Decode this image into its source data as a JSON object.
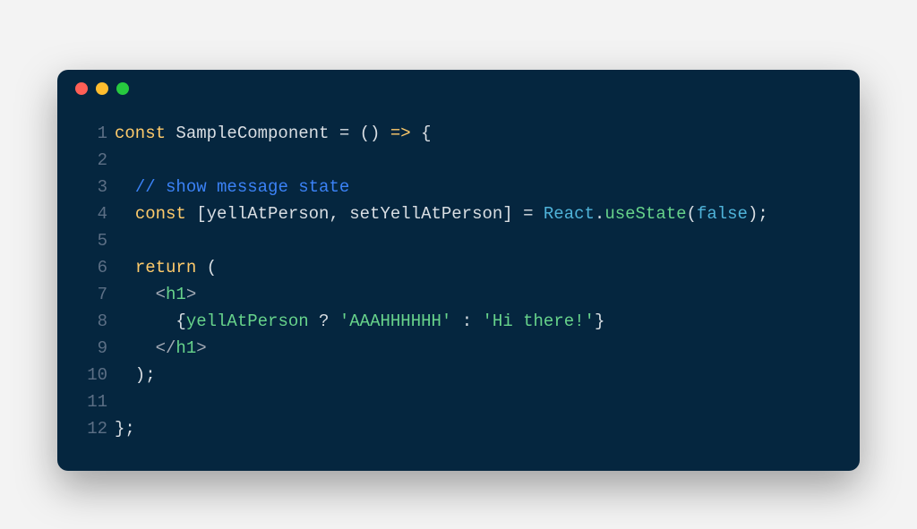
{
  "window": {
    "traffic_lights": [
      "red",
      "yellow",
      "green"
    ]
  },
  "code": {
    "lines": [
      {
        "n": "1",
        "tokens": [
          {
            "c": "tok-keyword",
            "t": "const"
          },
          {
            "c": "tok-default",
            "t": " SampleComponent = () "
          },
          {
            "c": "tok-keyword",
            "t": "=>"
          },
          {
            "c": "tok-default",
            "t": " {"
          }
        ]
      },
      {
        "n": "2",
        "tokens": [
          {
            "c": "tok-default",
            "t": ""
          }
        ]
      },
      {
        "n": "3",
        "tokens": [
          {
            "c": "tok-default",
            "t": "  "
          },
          {
            "c": "tok-comment",
            "t": "// show message state"
          }
        ]
      },
      {
        "n": "4",
        "tokens": [
          {
            "c": "tok-default",
            "t": "  "
          },
          {
            "c": "tok-keyword",
            "t": "const"
          },
          {
            "c": "tok-default",
            "t": " [yellAtPerson, setYellAtPerson] = "
          },
          {
            "c": "tok-class",
            "t": "React"
          },
          {
            "c": "tok-default",
            "t": "."
          },
          {
            "c": "tok-func",
            "t": "useState"
          },
          {
            "c": "tok-default",
            "t": "("
          },
          {
            "c": "tok-bool",
            "t": "false"
          },
          {
            "c": "tok-default",
            "t": ");"
          }
        ]
      },
      {
        "n": "5",
        "tokens": [
          {
            "c": "tok-default",
            "t": ""
          }
        ]
      },
      {
        "n": "6",
        "tokens": [
          {
            "c": "tok-default",
            "t": "  "
          },
          {
            "c": "tok-keyword",
            "t": "return"
          },
          {
            "c": "tok-default",
            "t": " ("
          }
        ]
      },
      {
        "n": "7",
        "tokens": [
          {
            "c": "tok-default",
            "t": "    "
          },
          {
            "c": "tok-tagpunc",
            "t": "<"
          },
          {
            "c": "tok-tag",
            "t": "h1"
          },
          {
            "c": "tok-tagpunc",
            "t": ">"
          }
        ]
      },
      {
        "n": "8",
        "tokens": [
          {
            "c": "tok-default",
            "t": "      {"
          },
          {
            "c": "tok-prop",
            "t": "yellAtPerson"
          },
          {
            "c": "tok-default",
            "t": " ? "
          },
          {
            "c": "tok-string",
            "t": "'AAAHHHHHH'"
          },
          {
            "c": "tok-default",
            "t": " : "
          },
          {
            "c": "tok-string",
            "t": "'Hi there!'"
          },
          {
            "c": "tok-default",
            "t": "}"
          }
        ]
      },
      {
        "n": "9",
        "tokens": [
          {
            "c": "tok-default",
            "t": "    "
          },
          {
            "c": "tok-tagpunc",
            "t": "</"
          },
          {
            "c": "tok-tag",
            "t": "h1"
          },
          {
            "c": "tok-tagpunc",
            "t": ">"
          }
        ]
      },
      {
        "n": "10",
        "tokens": [
          {
            "c": "tok-default",
            "t": "  );"
          }
        ]
      },
      {
        "n": "11",
        "tokens": [
          {
            "c": "tok-default",
            "t": ""
          }
        ]
      },
      {
        "n": "12",
        "tokens": [
          {
            "c": "tok-default",
            "t": "};"
          }
        ]
      }
    ]
  }
}
